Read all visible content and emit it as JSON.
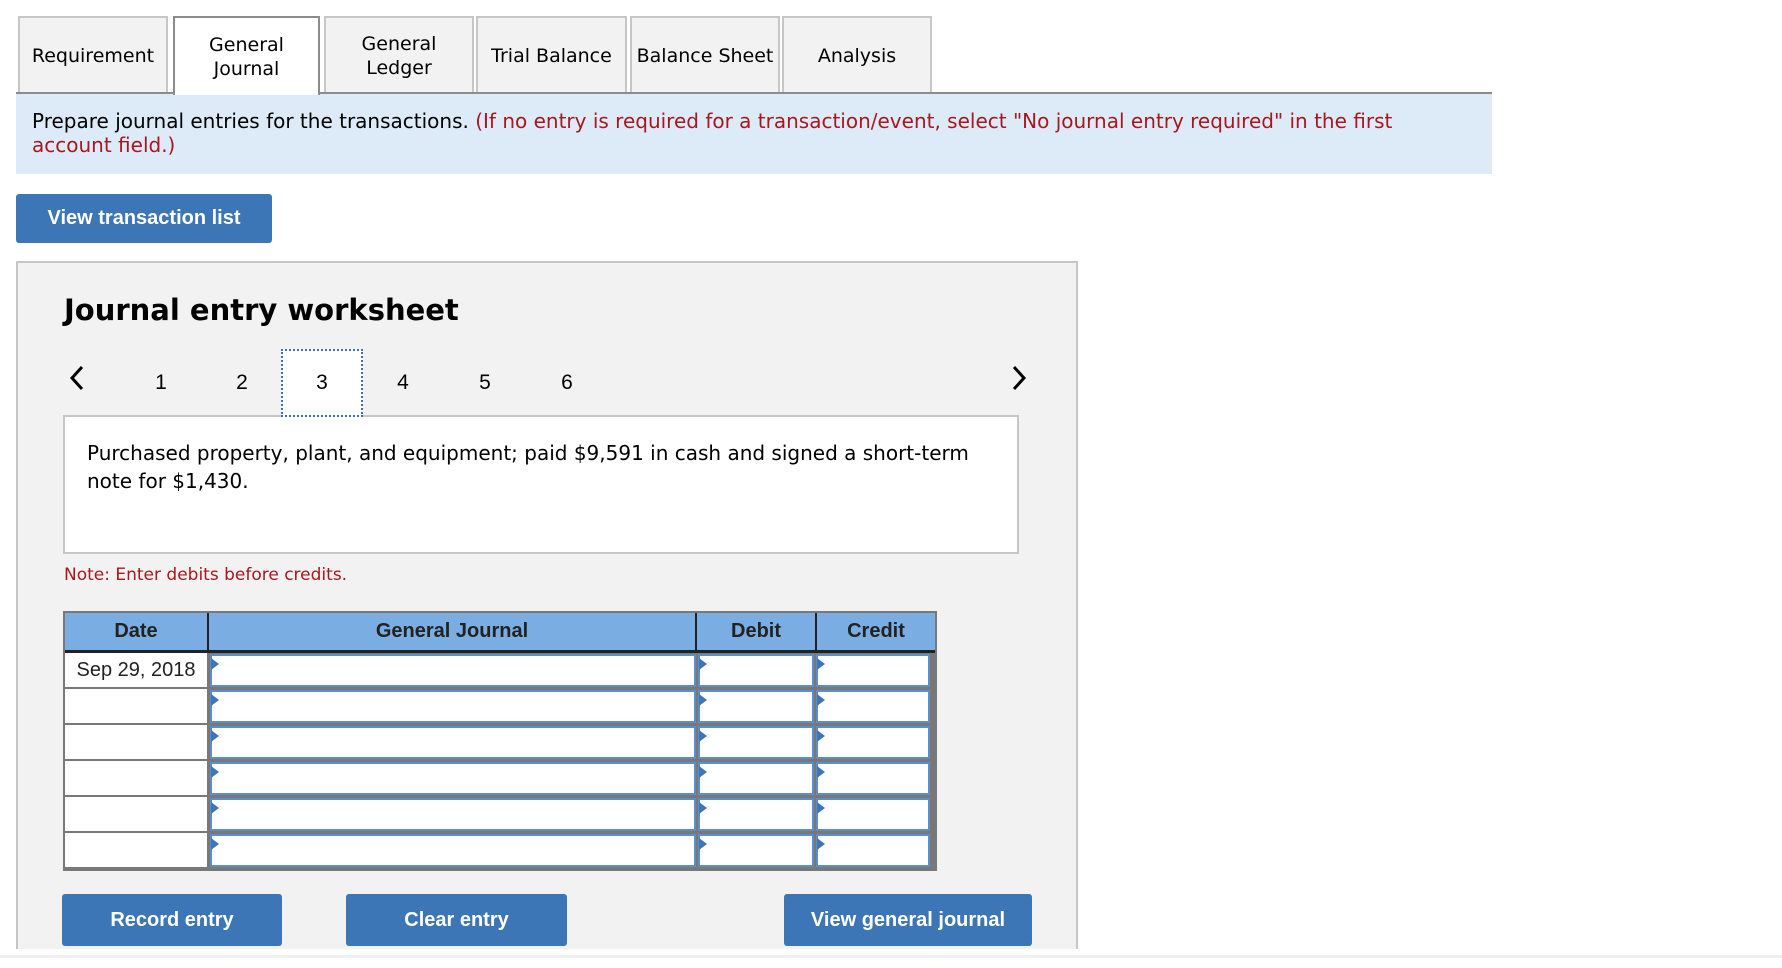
{
  "tabs": [
    {
      "label": "Requirement",
      "active": false
    },
    {
      "label": "General\nJournal",
      "active": true
    },
    {
      "label": "General\nLedger",
      "active": false
    },
    {
      "label": "Trial Balance",
      "active": false
    },
    {
      "label": "Balance Sheet",
      "active": false
    },
    {
      "label": "Analysis",
      "active": false
    }
  ],
  "instruction": {
    "main": "Prepare journal entries for the transactions. ",
    "note": "(If no entry is required for a transaction/event, select \"No journal entry required\" in the first account field.)"
  },
  "buttons": {
    "view_transaction_list": "View transaction list",
    "record_entry": "Record entry",
    "clear_entry": "Clear entry",
    "view_general_journal": "View general journal"
  },
  "worksheet": {
    "title": "Journal entry worksheet",
    "pager": {
      "prev_icon": "chevron-left-icon",
      "next_icon": "chevron-right-icon",
      "pages": [
        "1",
        "2",
        "3",
        "4",
        "5",
        "6"
      ],
      "current": "3"
    },
    "description": "Purchased property, plant, and equipment; paid $9,591 in cash and signed a short-term note for $1,430.",
    "note": "Note: Enter debits before credits.",
    "table": {
      "headers": {
        "date": "Date",
        "account": "General Journal",
        "debit": "Debit",
        "credit": "Credit"
      },
      "rows": [
        {
          "date": "Sep 29, 2018",
          "account": "",
          "debit": "",
          "credit": ""
        },
        {
          "date": "",
          "account": "",
          "debit": "",
          "credit": ""
        },
        {
          "date": "",
          "account": "",
          "debit": "",
          "credit": ""
        },
        {
          "date": "",
          "account": "",
          "debit": "",
          "credit": ""
        },
        {
          "date": "",
          "account": "",
          "debit": "",
          "credit": ""
        },
        {
          "date": "",
          "account": "",
          "debit": "",
          "credit": ""
        }
      ]
    }
  },
  "colors": {
    "button_blue": "#3d76b7",
    "header_blue": "#7aaee2",
    "instruction_bg": "#dcebf7",
    "note_red": "#a8171d"
  }
}
